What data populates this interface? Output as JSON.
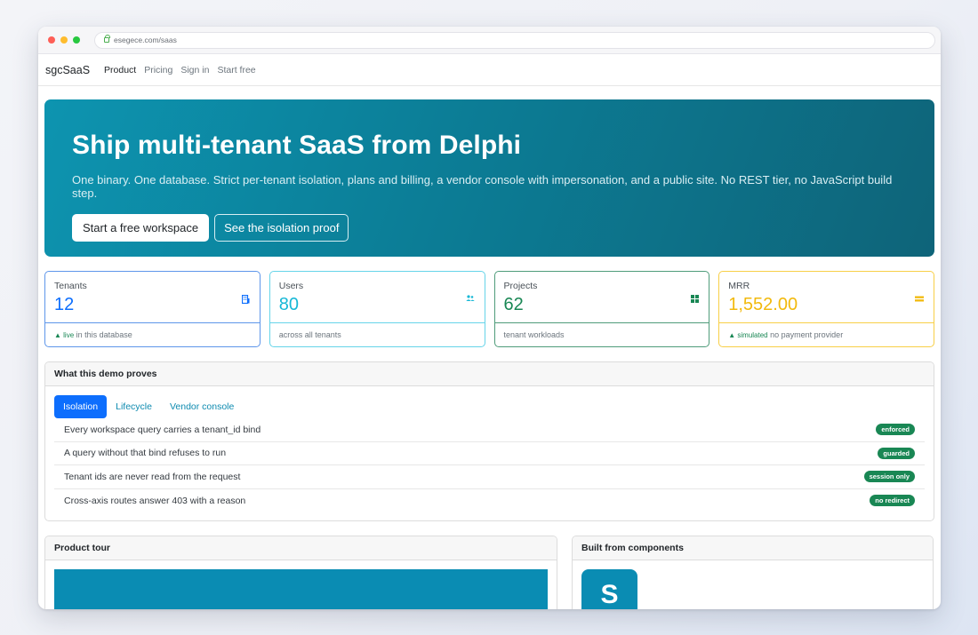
{
  "browser": {
    "url": "esegece.com/saas"
  },
  "nav": {
    "brand": "sgcSaaS",
    "links": [
      {
        "label": "Product",
        "active": true
      },
      {
        "label": "Pricing"
      },
      {
        "label": "Sign in"
      },
      {
        "label": "Start free"
      }
    ]
  },
  "hero": {
    "title": "Ship multi-tenant SaaS from Delphi",
    "subtitle": "One binary. One database. Strict per-tenant isolation, plans and billing, a vendor console with impersonation, and a public site. No REST tier, no JavaScript build step.",
    "primary_cta": "Start a free workspace",
    "secondary_cta": "See the isolation proof"
  },
  "stats": [
    {
      "label": "Tenants",
      "value": "12",
      "icon": "building-icon",
      "foot_highlight": "▲ live",
      "foot_text": " in this database",
      "color": "#0d6efd"
    },
    {
      "label": "Users",
      "value": "80",
      "icon": "people-icon",
      "foot_highlight": "",
      "foot_text": "across all tenants",
      "color": "#17b8d6"
    },
    {
      "label": "Projects",
      "value": "62",
      "icon": "grid-icon",
      "foot_highlight": "",
      "foot_text": "tenant workloads",
      "color": "#198754"
    },
    {
      "label": "MRR",
      "value": "1,552.00",
      "icon": "cash-icon",
      "foot_highlight": "▲ simulated",
      "foot_text": " no payment provider",
      "color": "#f2b90c"
    }
  ],
  "proves": {
    "title": "What this demo proves",
    "tabs": [
      {
        "label": "Isolation",
        "active": true
      },
      {
        "label": "Lifecycle"
      },
      {
        "label": "Vendor console"
      }
    ],
    "rows": [
      {
        "text": "Every workspace query carries a tenant_id bind",
        "badge": "enforced"
      },
      {
        "text": "A query without that bind refuses to run",
        "badge": "guarded"
      },
      {
        "text": "Tenant ids are never read from the request",
        "badge": "session only"
      },
      {
        "text": "Cross-axis routes answer 403 with a reason",
        "badge": "no redirect"
      }
    ]
  },
  "tour": {
    "title": "Product tour"
  },
  "built": {
    "title": "Built from components",
    "tile_letter": "S"
  }
}
